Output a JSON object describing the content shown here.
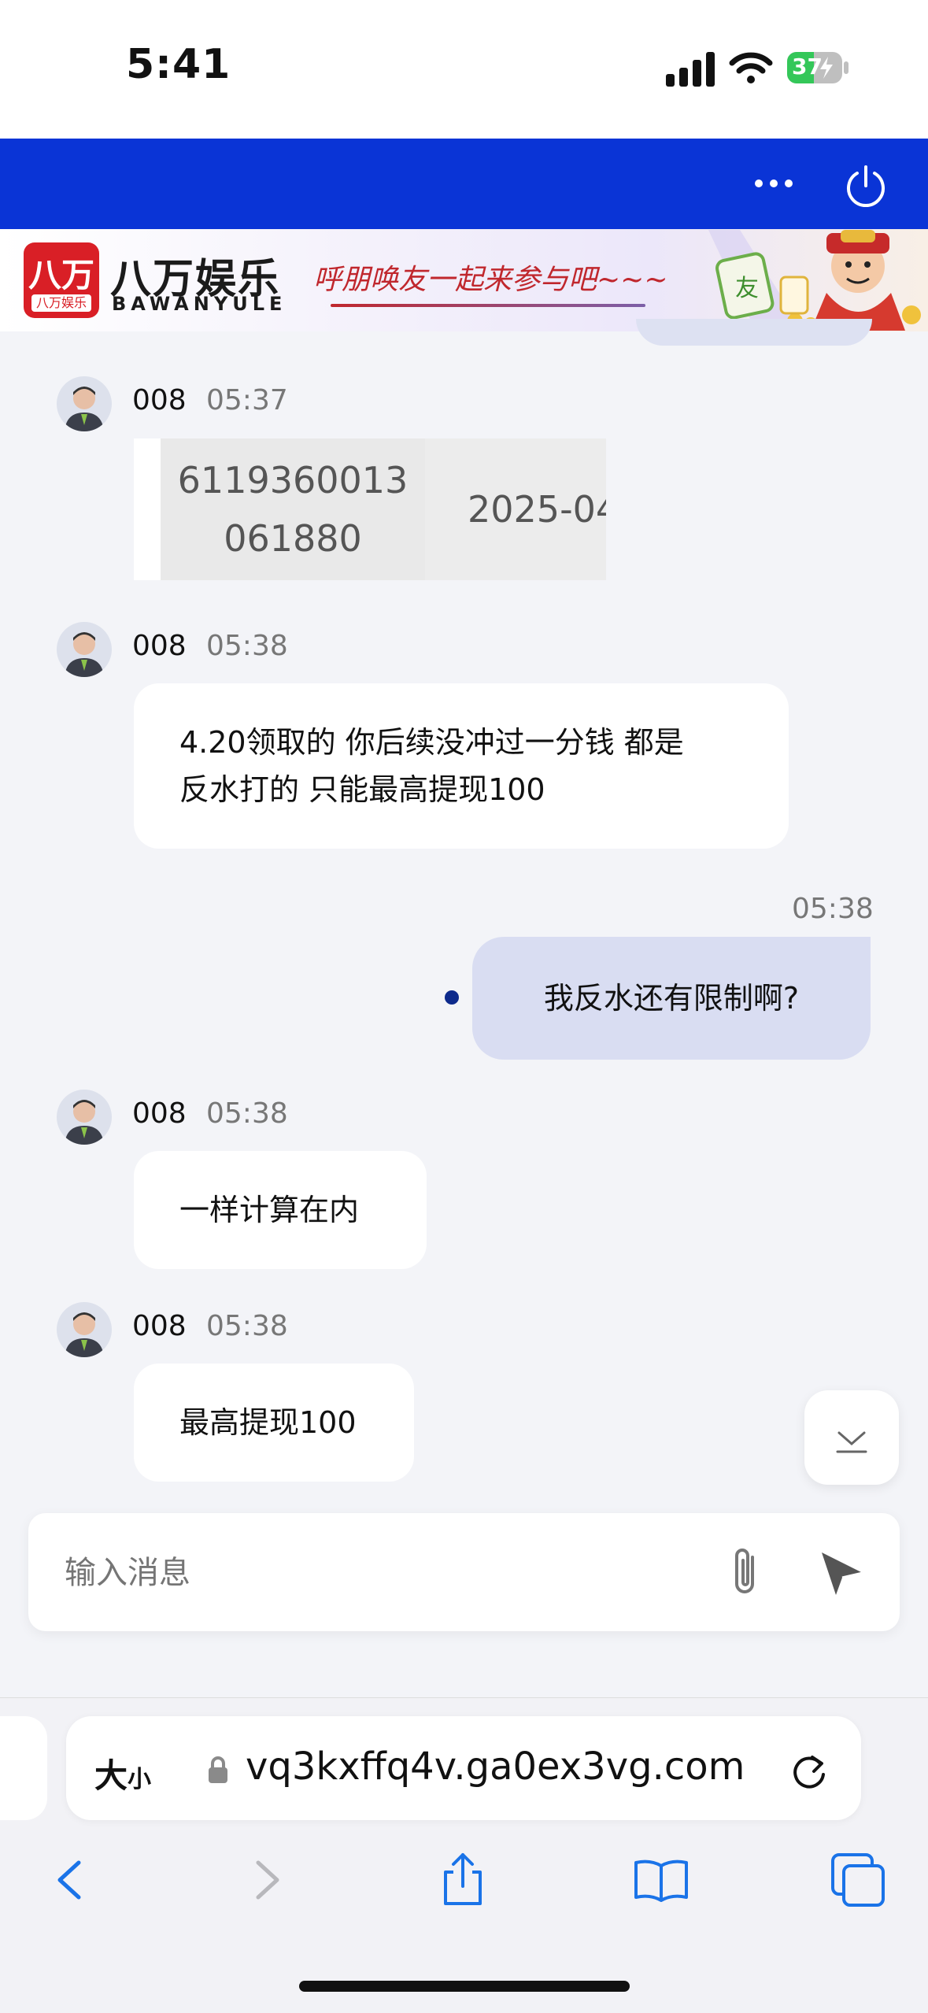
{
  "status_bar": {
    "time": "5:41",
    "battery": "37"
  },
  "banner": {
    "logo_main": "八万",
    "logo_sub": "八万娱乐",
    "brand_cn": "八万娱乐",
    "brand_en": "BAWANYULE",
    "slogan": "呼朋唤友一起来参与吧~~~"
  },
  "chat": {
    "messages": [
      {
        "sender": "008",
        "time": "05:37",
        "type": "image",
        "image_text_1": "6119360013\n061880",
        "image_text_2": "2025-04"
      },
      {
        "sender": "008",
        "time": "05:38",
        "text_line1": "4.20领取的 你后续没冲过一分钱 都是",
        "text_line2": "反水打的 只能最高提现100"
      },
      {
        "sender": "me",
        "time": "05:38",
        "text": "我反水还有限制啊?"
      },
      {
        "sender": "008",
        "time": "05:38",
        "text": "一样计算在内"
      },
      {
        "sender": "008",
        "time": "05:38",
        "text": "最高提现100"
      }
    ]
  },
  "input": {
    "placeholder": "输入消息"
  },
  "browser": {
    "aa_big": "大",
    "aa_small": "小",
    "url": "vq3kxffq4v.ga0ex3vg.com"
  },
  "colors": {
    "header_blue": "#0a34d6",
    "my_bubble": "#d9ddf2",
    "ios_blue": "#1a73e8"
  }
}
